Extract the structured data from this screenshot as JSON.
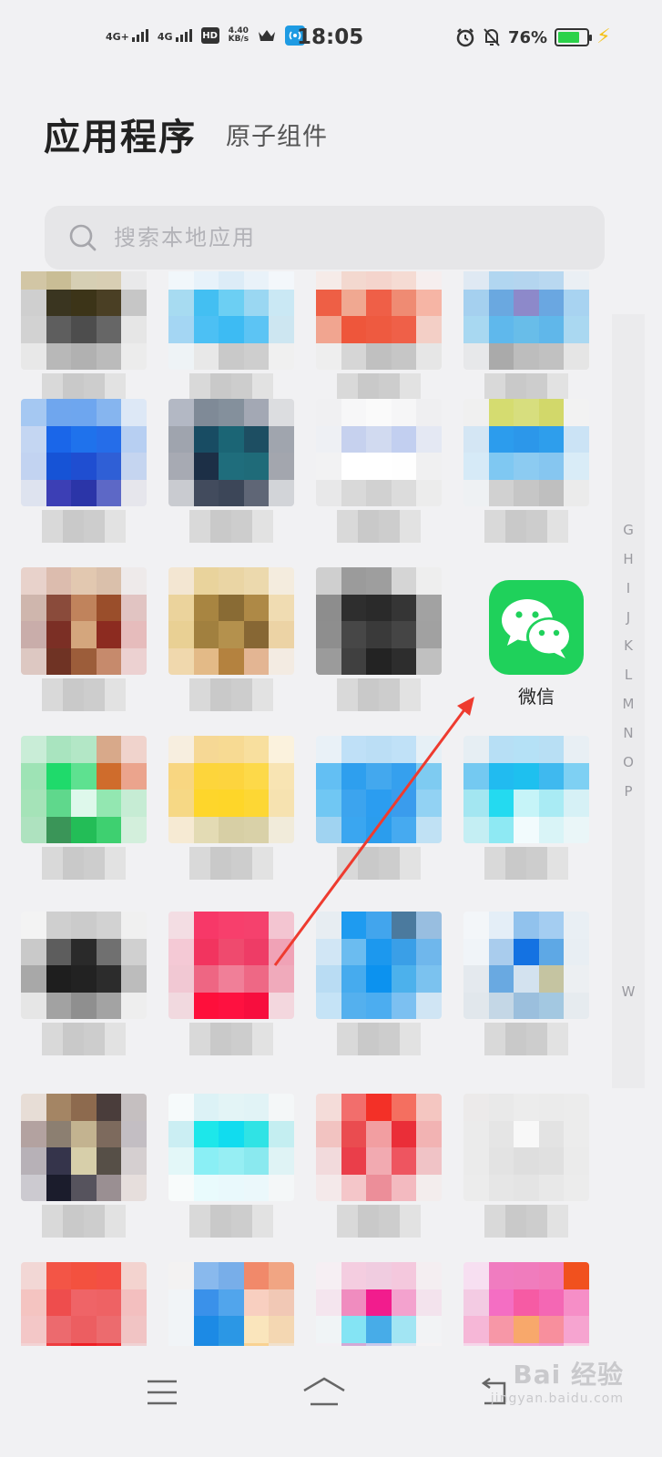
{
  "status_bar": {
    "net1": "4G+",
    "net2": "4G",
    "hd": "HD",
    "sim_nums": "1\n2",
    "speed_value": "4.40",
    "speed_unit": "KB/s",
    "time": "18:05",
    "battery_pct": "76%",
    "battery_level": 0.76
  },
  "header": {
    "title": "应用程序",
    "subtitle": "原子组件"
  },
  "search": {
    "placeholder": "搜索本地应用"
  },
  "wechat": {
    "label": "微信",
    "color": "#1fd15b"
  },
  "index_bar": {
    "letters": [
      "G",
      "H",
      "I",
      "J",
      "K",
      "L",
      "M",
      "N",
      "O",
      "P",
      "W"
    ]
  },
  "apps": [
    [
      "#d2c6a5",
      "#c9bd95",
      "#d6cfb4",
      "#d8ceb3",
      "#e9e9ea",
      "#cfcfcf",
      "#3a3520",
      "#3c3418",
      "#4a3f24",
      "#c6c6c6",
      "#d2d2d2",
      "#5e5e5e",
      "#4d4d4d",
      "#666666",
      "#e6e6e6",
      "#e8e8e8",
      "#b8b8b8",
      "#b1b1b1",
      "#bbbbbb",
      "#ececec"
    ],
    [
      "#f1f7fb",
      "#e7f2fa",
      "#dcecf7",
      "#e9f2f9",
      "#f3f7fb",
      "#a7dbf1",
      "#43bff2",
      "#6ccff3",
      "#9ad7f2",
      "#cae8f4",
      "#a4d6f3",
      "#4cc0f4",
      "#3dbbf3",
      "#5cc4f4",
      "#cde6f1",
      "#eef3f6",
      "#e8e8e8",
      "#c9c9c9",
      "#cecece",
      "#f0f0f0"
    ],
    [
      "#f6ebe8",
      "#f3d8cf",
      "#f4d4cc",
      "#f5dbd3",
      "#f6eeee",
      "#ee5f45",
      "#f0a891",
      "#ef5f47",
      "#ef8b73",
      "#f6b5a5",
      "#f1a590",
      "#ee563b",
      "#ee5a40",
      "#ef6048",
      "#f3cfc6",
      "#eeeeee",
      "#d6d6d6",
      "#c0c0c0",
      "#c6c6c6",
      "#e6e6e6"
    ],
    [
      "#dfe9f3",
      "#b1d6f0",
      "#b4d5ef",
      "#b9d8f0",
      "#eaeff4",
      "#a5d0ef",
      "#6aa8e0",
      "#8d89ca",
      "#6aa7e1",
      "#a8d3f1",
      "#a8d8f1",
      "#5fb8ec",
      "#68bde9",
      "#60b7ea",
      "#aad8f1",
      "#e7e8ea",
      "#aaaaaa",
      "#bdbdbd",
      "#c1c1c1",
      "#e5e5e5"
    ],
    [
      "#a5c8f2",
      "#6fa6ee",
      "#6ea6ef",
      "#86b5ef",
      "#dde8f6",
      "#c4d6f2",
      "#1a66e9",
      "#1f72ec",
      "#256de9",
      "#b7cff2",
      "#c2d3f1",
      "#1653d6",
      "#1f4ed1",
      "#2f5fd6",
      "#c5d5f0",
      "#dee3ef",
      "#3c3fb5",
      "#2b35a8",
      "#5d68c6",
      "#e6e6ec"
    ],
    [
      "#b3b8c4",
      "#7f8a97",
      "#84909c",
      "#a3a8b4",
      "#dcdde0",
      "#9fa4ae",
      "#184c63",
      "#1b6575",
      "#1d4e62",
      "#a0a5ae",
      "#a7aab3",
      "#1c2f46",
      "#1f6d7c",
      "#1f6b79",
      "#a3a6ae",
      "#c9cbd0",
      "#424b5d",
      "#3c4658",
      "#5f6676",
      "#d2d4d8"
    ],
    [
      "#f0f0f2",
      "#f7f7f8",
      "#fafafa",
      "#f6f6f7",
      "#efeff1",
      "#eef0f4",
      "#c6d1ee",
      "#d1daf0",
      "#c2cff0",
      "#e4e8f3",
      "#f2f2f3",
      "#ffffff",
      "#ffffff",
      "#fefefe",
      "#f0f0f1",
      "#e8e8e9",
      "#d9d9d9",
      "#d1d1d1",
      "#dcdcdc",
      "#ececec"
    ],
    [
      "#f0f0f0",
      "#d5dc70",
      "#d7de7e",
      "#d2d86a",
      "#f2f2f2",
      "#d4e6f4",
      "#2c9ced",
      "#2c97ea",
      "#2e9eec",
      "#cbe3f5",
      "#d6eaf7",
      "#7fc8f2",
      "#8ccbf1",
      "#86c6f0",
      "#d9ecf7",
      "#eef1f3",
      "#d1d1d1",
      "#c6c6c6",
      "#bfbfbf",
      "#ebebeb"
    ],
    [
      "#e8d2cb",
      "#dcbcae",
      "#e2c8b0",
      "#dac0ab",
      "#eeeaea",
      "#cfb6ad",
      "#8a4b3b",
      "#c0835c",
      "#9a4e2b",
      "#e1c4c2",
      "#c9adaa",
      "#7b2f25",
      "#d4a67d",
      "#8c2b20",
      "#e6bcbc",
      "#ddc8c2",
      "#6f3324",
      "#9c5d3a",
      "#c68a6c",
      "#ecd1d1"
    ],
    [
      "#f3e6d2",
      "#e9d39c",
      "#ead5a4",
      "#ecd9ad",
      "#f4ecde",
      "#ebd39c",
      "#a88541",
      "#896b34",
      "#ae8946",
      "#f0dcb2",
      "#e9d094",
      "#a1803f",
      "#b4914d",
      "#876734",
      "#ecd3a5",
      "#f0d8ad",
      "#e3ba87",
      "#b4823f",
      "#e3b593",
      "#f3ebe2"
    ],
    [
      "#cfcfcf",
      "#9b9b9b",
      "#9e9e9e",
      "#d5d5d5",
      "#eeeeee",
      "#8d8d8d",
      "#2e2e2e",
      "#2a2a2a",
      "#353535",
      "#a2a2a2",
      "#8e8e8e",
      "#474747",
      "#3a3a3a",
      "#454545",
      "#a1a1a1",
      "#9b9b9b",
      "#404040",
      "#232323",
      "#2d2d2d",
      "#c0c0c0"
    ],
    [
      "#dcdcdc",
      "#c9c9c9",
      "#c9c9c9",
      "#dadada",
      "#e6e6e6",
      "#1bd65b",
      "#f8f8f8",
      "#f8f8f8",
      "#1fd55c",
      "#d8d8d8",
      "#1ed35a",
      "#f7f7f7",
      "#f7f7f7",
      "#21d45e",
      "#d8d8d8",
      "#e4e4e4",
      "#1dc755",
      "#1fcb57",
      "#27c85d",
      "#e8e8e8"
    ],
    [
      "#c9edd7",
      "#a9e4bf",
      "#b3e7c6",
      "#d8a98a",
      "#f0d3cc",
      "#9ee3b5",
      "#1fda6b",
      "#5ee190",
      "#cf6c2c",
      "#eba48d",
      "#a5e3b8",
      "#5fd88c",
      "#def8eb",
      "#93e7b1",
      "#c6ecd4",
      "#aee2bf",
      "#3a9558",
      "#23bd57",
      "#3ed070",
      "#d3efdc"
    ],
    [
      "#f7eedf",
      "#f6d895",
      "#f7da93",
      "#f8df9e",
      "#fbf2dd",
      "#f8d681",
      "#fdd53b",
      "#fdd43e",
      "#fdd949",
      "#f8e4b3",
      "#f6d885",
      "#fed62b",
      "#fed629",
      "#fdd734",
      "#f6e2b0",
      "#f6ead3",
      "#e3dbb4",
      "#d7cfa5",
      "#d9d1a8",
      "#f1ebda"
    ],
    [
      "#e9f1f7",
      "#bfe0f7",
      "#bbdef5",
      "#c0e1f7",
      "#e6f0f6",
      "#63bff3",
      "#2e9fee",
      "#43a8ee",
      "#35a0ee",
      "#7ecbf1",
      "#70c7f3",
      "#3ca4ee",
      "#2b9df0",
      "#3a9ced",
      "#92d2f3",
      "#a0d3f1",
      "#3aa6f0",
      "#2b9ded",
      "#46aaf0",
      "#c0e1f4"
    ],
    [
      "#e6eef3",
      "#b7dff5",
      "#b5e1f6",
      "#b8dff4",
      "#e8eff4",
      "#74c9f1",
      "#21bbf0",
      "#1ec0ef",
      "#3fb9ef",
      "#7ed0f3",
      "#a3e6f1",
      "#24daf0",
      "#c6f4f8",
      "#a9ebf4",
      "#d6f1f6",
      "#c4eef3",
      "#8ee9f3",
      "#f2fbfd",
      "#d9f4f7",
      "#eaf6f8"
    ],
    [
      "#f3f3f3",
      "#cfcfcf",
      "#cbcbcb",
      "#d2d2d2",
      "#f0f0f0",
      "#c9c9c9",
      "#5d5d5d",
      "#2a2a2a",
      "#707070",
      "#d0d0d0",
      "#a8a8a8",
      "#1e1e1e",
      "#222222",
      "#2c2c2c",
      "#bcbcbc",
      "#e6e6e6",
      "#a2a2a2",
      "#8f8f8f",
      "#a3a3a3",
      "#eeeeee"
    ],
    [
      "#f3dde3",
      "#f73868",
      "#f73f6c",
      "#f5416d",
      "#f3c5d1",
      "#f4c9d5",
      "#f2345f",
      "#ef4a6e",
      "#ee3c66",
      "#f0a2b6",
      "#f1c8d3",
      "#ee6683",
      "#f07f98",
      "#ee6885",
      "#f0aabb",
      "#f1d9df",
      "#fe0f3b",
      "#fe1140",
      "#f70e3e",
      "#f3d7de"
    ],
    [
      "#e7edf2",
      "#1e9bf0",
      "#42a5ed",
      "#4b7a9e",
      "#98bee0",
      "#d1e6f5",
      "#6bbcf0",
      "#1c98ee",
      "#3a9fe7",
      "#6fb7ec",
      "#b9dcf3",
      "#46abee",
      "#0c92ef",
      "#4cb1ec",
      "#7bc2ef",
      "#c5e3f6",
      "#54b0ee",
      "#4cadf0",
      "#7cc0f1",
      "#d0e5f4"
    ],
    [
      "#f3f6f9",
      "#e4eef7",
      "#91c2ed",
      "#a4cdf1",
      "#e9eff4",
      "#f0f4f8",
      "#a9cced",
      "#1472e2",
      "#5ea8e5",
      "#e8eef3",
      "#e4e9ee",
      "#69a9e1",
      "#d3e2ef",
      "#c5c4a1",
      "#eceff2",
      "#e1e7ec",
      "#c4d7e6",
      "#9bbfdd",
      "#a3c8e1",
      "#e6ebef"
    ],
    [
      "#e7ddd6",
      "#a48564",
      "#8d6a4e",
      "#4a3d3b",
      "#c5bfc0",
      "#b3a2a0",
      "#8c7f71",
      "#c3b390",
      "#7d6a5d",
      "#c3bec3",
      "#b7b1b7",
      "#35344b",
      "#d7cfaa",
      "#564f47",
      "#d5cfd0",
      "#cccad0",
      "#1b1c2c",
      "#56535d",
      "#9a8f92",
      "#e6dedc"
    ],
    [
      "#f6fafb",
      "#dcf2f6",
      "#e3f4f6",
      "#e1f3f6",
      "#f4f7f8",
      "#cbeef3",
      "#1de7ea",
      "#11dcef",
      "#30e3e5",
      "#c4eef1",
      "#e3f7f8",
      "#8aeff5",
      "#96eef3",
      "#8ae9ef",
      "#dff3f5",
      "#f8fbfb",
      "#e9fbfd",
      "#e9f9fc",
      "#ebf8fb",
      "#f4f7f8"
    ],
    [
      "#f4dcd9",
      "#f26e6c",
      "#f33027",
      "#f46f60",
      "#f4c6c1",
      "#f2c3c1",
      "#ea4c50",
      "#f29ea1",
      "#ea2e38",
      "#f2b3b3",
      "#f2dadc",
      "#ea3e4a",
      "#f2aab1",
      "#ee5560",
      "#f0c3c6",
      "#f4e9ea",
      "#f4c6c9",
      "#ec8e99",
      "#f3bac0",
      "#f3eded"
    ],
    [
      "#eceaea",
      "#e9e9e9",
      "#ececec",
      "#ebebeb",
      "#ececec",
      "#ebebeb",
      "#e5e5e5",
      "#f8f8f8",
      "#e3e3e3",
      "#ececec",
      "#ebebeb",
      "#e3e3e3",
      "#dedede",
      "#e0e0e0",
      "#ebebeb",
      "#ececec",
      "#e6e6e6",
      "#e4e4e4",
      "#e8e8e8",
      "#ececec"
    ],
    [
      "#f2d7d5",
      "#f35546",
      "#f3513f",
      "#f34f44",
      "#f3d3cf",
      "#f4c4c1",
      "#ee4d4d",
      "#ef6467",
      "#ee6264",
      "#f3bfbf",
      "#f3c7c7",
      "#ec6a6e",
      "#ec5e61",
      "#ec6b6e",
      "#f1c4c4",
      "#f3d3d4",
      "#ee3d3f",
      "#ef1f24",
      "#ee2a2e",
      "#f0d2d3"
    ],
    [
      "#f3f2f2",
      "#89b9ed",
      "#78aee9",
      "#f1896a",
      "#f1a583",
      "#f1f4f7",
      "#3a91ea",
      "#51a5ec",
      "#f8cfc0",
      "#f1c8b5",
      "#f1f4f7",
      "#1c8ae5",
      "#2b97e5",
      "#fae5bc",
      "#f4d7b2",
      "#f1f4f7",
      "#1c8ae2",
      "#2d9be2",
      "#f9d291",
      "#f1e1cd"
    ],
    [
      "#f6eff3",
      "#f4cde0",
      "#f0cce0",
      "#f4c8dd",
      "#f4eef1",
      "#f4e5ee",
      "#f08cbf",
      "#f21c8d",
      "#f3a2ce",
      "#f3e3ed",
      "#f0f4f6",
      "#84e4f4",
      "#47ace8",
      "#a2e5f3",
      "#f2f3f5",
      "#f3f0f4",
      "#d3a9d6",
      "#c7c8ea",
      "#e0e6f1",
      "#f5f3f4"
    ],
    [
      "#f7dff1",
      "#f07cc0",
      "#f07cbd",
      "#f27ab9",
      "#f1511e",
      "#f3cbe3",
      "#f46ec3",
      "#f65ba4",
      "#f467b4",
      "#f68ec7",
      "#f6b7d7",
      "#f797a7",
      "#f8a86b",
      "#f88f9d",
      "#f6a4d0",
      "#f6d6ea",
      "#f4a7cf",
      "#f2a2d0",
      "#f29bcf",
      "#f8cfe6"
    ]
  ]
}
